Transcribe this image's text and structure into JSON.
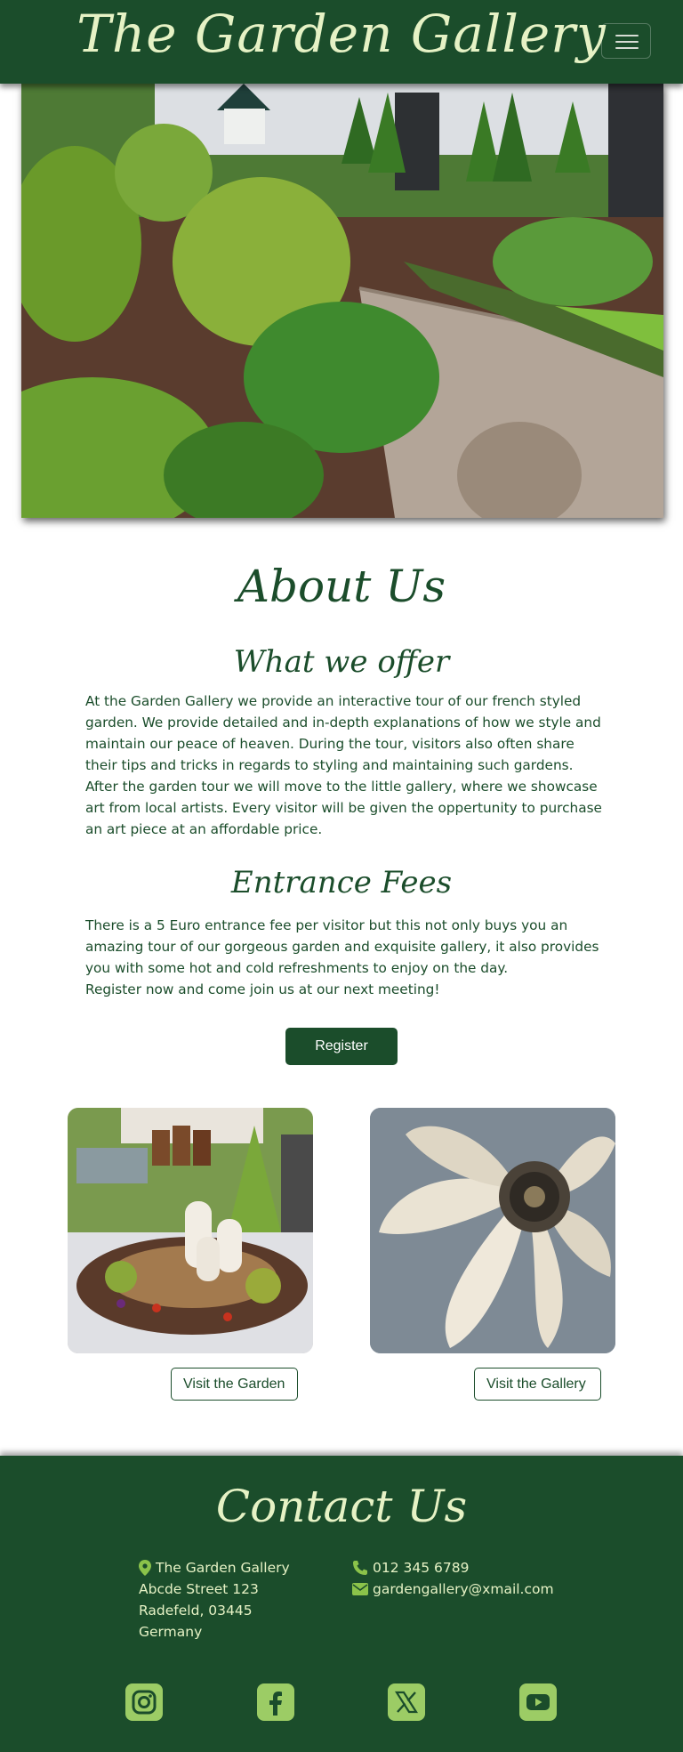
{
  "navbar": {
    "brand": "The Garden Gallery",
    "menu_toggle_icon": "hamburger-icon"
  },
  "hero": {
    "image": "garden-path-photo"
  },
  "about": {
    "title": "About Us",
    "offer_heading": "What we offer",
    "offer_text": "At the Garden Gallery we provide an interactive tour of our french styled garden. We provide detailed and in-depth explanations of how we style and maintain our peace of heaven. During the tour, visitors also often share their tips and tricks in regards to styling and maintaining such gardens. After the garden tour we will move to the little gallery, where we showcase art from local artists. Every visitor will be given the oppertunity to purchase an art piece at an affordable price.",
    "fees_heading": "Entrance Fees",
    "fees_text_1": "There is a 5 Euro entrance fee per visitor but this not only buys you an amazing tour of our gorgeous garden and exquisite gallery, it also provides you with some hot and cold refreshments to enjoy on the day.",
    "fees_text_2": "Register now and come join us at our next meeting!",
    "register_label": "Register"
  },
  "cards": {
    "garden_button": "Visit the Garden",
    "gallery_button": "Visit the Gallery"
  },
  "contact": {
    "title": "Contact Us",
    "name": "The Garden Gallery",
    "street": "Abcde Street 123",
    "city": "Radefeld, 03445",
    "country": "Germany",
    "phone": "012 345 6789",
    "email": "gardengallery@xmail.com"
  },
  "socials": [
    "instagram-icon",
    "facebook-icon",
    "x-icon",
    "youtube-icon"
  ],
  "colors": {
    "primary": "#1b4d2b",
    "accent_text": "#e6f2c5",
    "icon_green": "#9ccc65"
  }
}
